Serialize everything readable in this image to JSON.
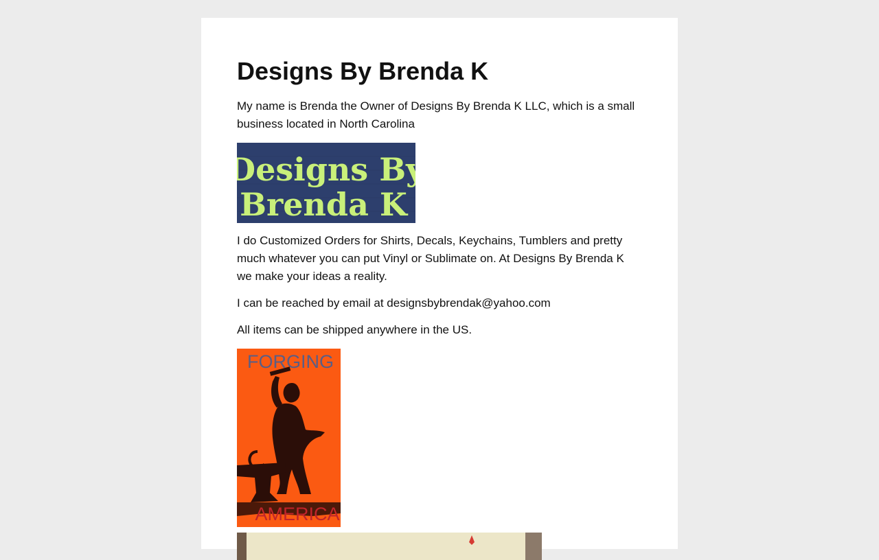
{
  "page": {
    "title": "Designs By Brenda K",
    "intro": "My name is Brenda the Owner of Designs By Brenda K LLC, which is a small business located in North Carolina",
    "services": "I do Customized Orders for Shirts, Decals, Keychains, Tumblers and pretty much whatever you can put Vinyl or Sublimate on. At Designs By Brenda K we make your ideas a reality.",
    "contact": "I can be reached by email at designsbybrendak@yahoo.com",
    "shipping": "All items can be shipped anywhere in the US."
  },
  "images": {
    "logo": {
      "line1": "Designs By",
      "line2": "Brenda K"
    },
    "forging": {
      "top": "FORGING",
      "bottom": "AMERICA"
    }
  },
  "colors": {
    "page_bg": "#ececec",
    "card_bg": "#ffffff",
    "logo_bg": "#2d3f6d",
    "logo_text": "#c9f07a",
    "forging_bg": "#fb5a12"
  }
}
